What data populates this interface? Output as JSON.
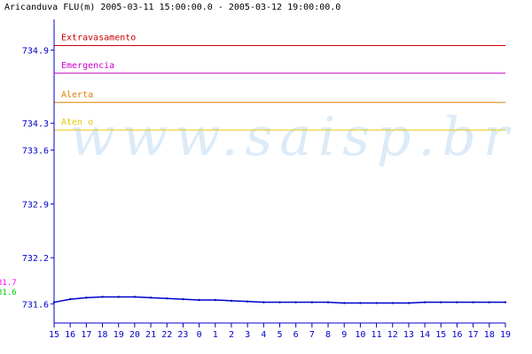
{
  "chart_data": {
    "type": "line",
    "title": "Aricanduva FLU(m) 2005-03-11 15:00:00.0 - 2005-03-12 19:00:00.0",
    "watermark": "www.saisp.br",
    "ylim": [
      731.35,
      735.3
    ],
    "yticks": [
      "731.6",
      "732.2",
      "732.9",
      "733.6",
      "734.3",
      "734.9"
    ],
    "ytick_values": [
      731.6,
      732.2,
      732.9,
      733.6,
      733.95,
      734.9
    ],
    "xticks": [
      "15",
      "16",
      "17",
      "18",
      "19",
      "20",
      "21",
      "22",
      "23",
      "0",
      "1",
      "2",
      "3",
      "4",
      "5",
      "6",
      "7",
      "8",
      "9",
      "10",
      "11",
      "12",
      "13",
      "14",
      "15",
      "16",
      "17",
      "18",
      "19"
    ],
    "thresholds": [
      {
        "label": "Extravasamento",
        "value": 734.96,
        "color": "#cc0000"
      },
      {
        "label": "Emergencia",
        "value": 734.6,
        "color": "#cc00cc"
      },
      {
        "label": "Alerta",
        "value": 734.22,
        "color": "#e08000"
      },
      {
        "label": "Aten  o",
        "value": 733.86,
        "color": "#e8c800"
      }
    ],
    "markers": [
      {
        "label": "31.7",
        "color": "#ff00ff"
      },
      {
        "label": "31.6",
        "color": "#00cc00"
      }
    ],
    "series": [
      {
        "color": "#0000cc",
        "x": [
          0,
          1,
          2,
          3,
          4,
          5,
          6,
          7,
          8,
          9,
          10,
          11,
          12,
          13,
          14,
          15,
          16,
          17,
          18,
          19,
          20,
          21,
          22,
          23,
          24,
          25,
          26,
          27,
          28
        ],
        "y": [
          731.62,
          731.66,
          731.68,
          731.69,
          731.69,
          731.69,
          731.68,
          731.67,
          731.66,
          731.65,
          731.65,
          731.64,
          731.63,
          731.62,
          731.62,
          731.62,
          731.62,
          731.62,
          731.61,
          731.61,
          731.61,
          731.61,
          731.61,
          731.62,
          731.62,
          731.62,
          731.62,
          731.62,
          731.62
        ]
      }
    ]
  }
}
